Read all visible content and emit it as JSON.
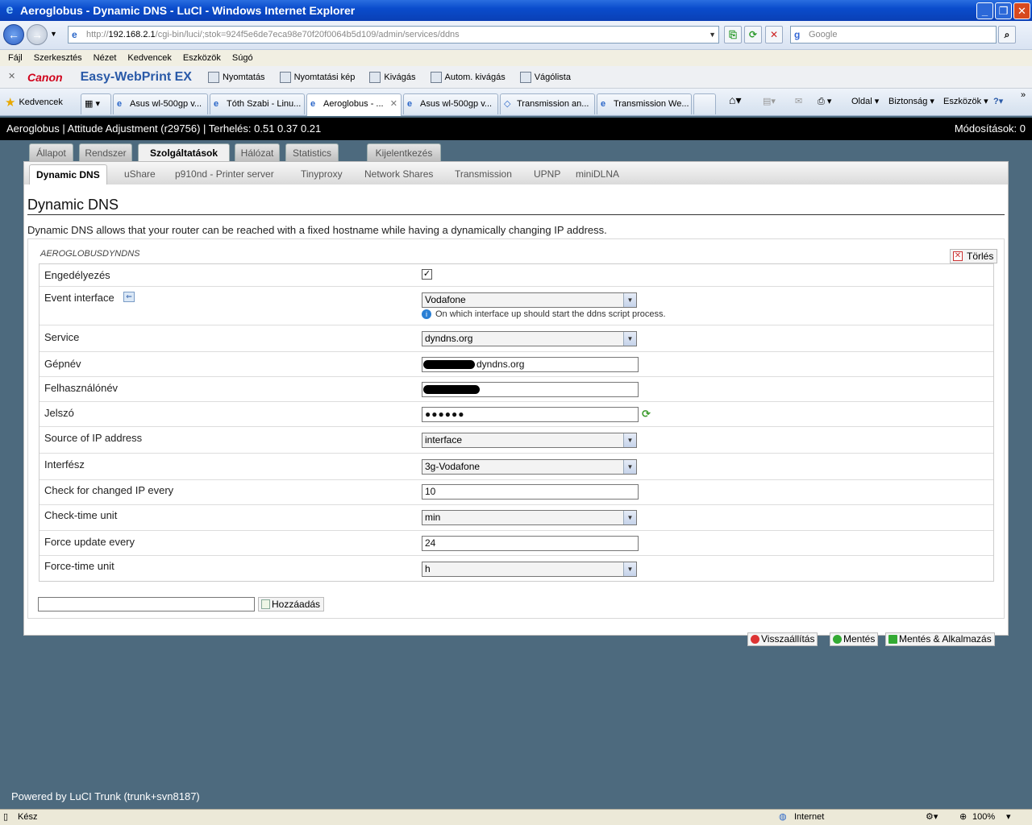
{
  "window": {
    "title": "Aeroglobus - Dynamic DNS - LuCI - Windows Internet Explorer",
    "address_base": "http://",
    "address_host": "192.168.2.1",
    "address_path": "/cgi-bin/luci/;stok=924f5e6de7eca98e70f20f0064b5d109/admin/services/ddns",
    "search_placeholder": "Google"
  },
  "menu": [
    "Fájl",
    "Szerkesztés",
    "Nézet",
    "Kedvencek",
    "Eszközök",
    "Súgó"
  ],
  "canon_toolbar": {
    "brand": "Canon",
    "product": "Easy-WebPrint EX",
    "items": [
      "Nyomtatás",
      "Nyomtatási kép",
      "Kivágás",
      "Autom. kivágás",
      "Vágólista"
    ]
  },
  "browser_tabs": {
    "favorites_label": "Kedvencek",
    "tabs": [
      "Asus wl-500gp v...",
      "Tóth Szabi - Linu...",
      "Aeroglobus - ...",
      "Asus wl-500gp v...",
      "Transmission an...",
      "Transmission We..."
    ],
    "commands": [
      "Oldal",
      "Biztonság",
      "Eszközök"
    ]
  },
  "luci": {
    "header": "Aeroglobus | Attitude Adjustment (r29756) | Terhelés: 0.51 0.37 0.21",
    "changes": "Módosítások: 0",
    "nav_tabs": [
      "Állapot",
      "Rendszer",
      "Szolgáltatások",
      "Hálózat",
      "Statistics",
      "Kijelentkezés"
    ],
    "sub_tabs": [
      "Dynamic DNS",
      "uShare",
      "p910nd - Printer server",
      "Tinyproxy",
      "Network Shares",
      "Transmission",
      "UPNP",
      "miniDLNA"
    ],
    "page_title": "Dynamic DNS",
    "description": "Dynamic DNS allows that your router can be reached with a fixed hostname while having a dynamically changing IP address.",
    "section_name": "AEROGLOBUSDYNDNS",
    "delete_label": "Törlés",
    "fields": {
      "enable": {
        "label": "Engedélyezés",
        "checked": "✓"
      },
      "event_interface": {
        "label": "Event interface",
        "value": "Vodafone",
        "hint": "On which interface up should start the ddns script process."
      },
      "service": {
        "label": "Service",
        "value": "dyndns.org"
      },
      "hostname": {
        "label": "Gépnév",
        "value": "dyndns.org"
      },
      "username": {
        "label": "Felhasználónév",
        "value": ""
      },
      "password": {
        "label": "Jelszó",
        "value": "●●●●●●"
      },
      "ip_source": {
        "label": "Source of IP address",
        "value": "interface"
      },
      "interface": {
        "label": "Interfész",
        "value": "3g-Vodafone"
      },
      "check_interval": {
        "label": "Check for changed IP every",
        "value": "10"
      },
      "check_unit": {
        "label": "Check-time unit",
        "value": "min"
      },
      "force_interval": {
        "label": "Force update every",
        "value": "24"
      },
      "force_unit": {
        "label": "Force-time unit",
        "value": "h"
      }
    },
    "add_label": "Hozzáadás",
    "actions": [
      "Visszaállítás",
      "Mentés",
      "Mentés & Alkalmazás"
    ],
    "footer": "Powered by LuCI Trunk (trunk+svn8187)"
  },
  "statusbar": {
    "left": "Kész",
    "zone": "Internet",
    "zoom": "100%"
  }
}
